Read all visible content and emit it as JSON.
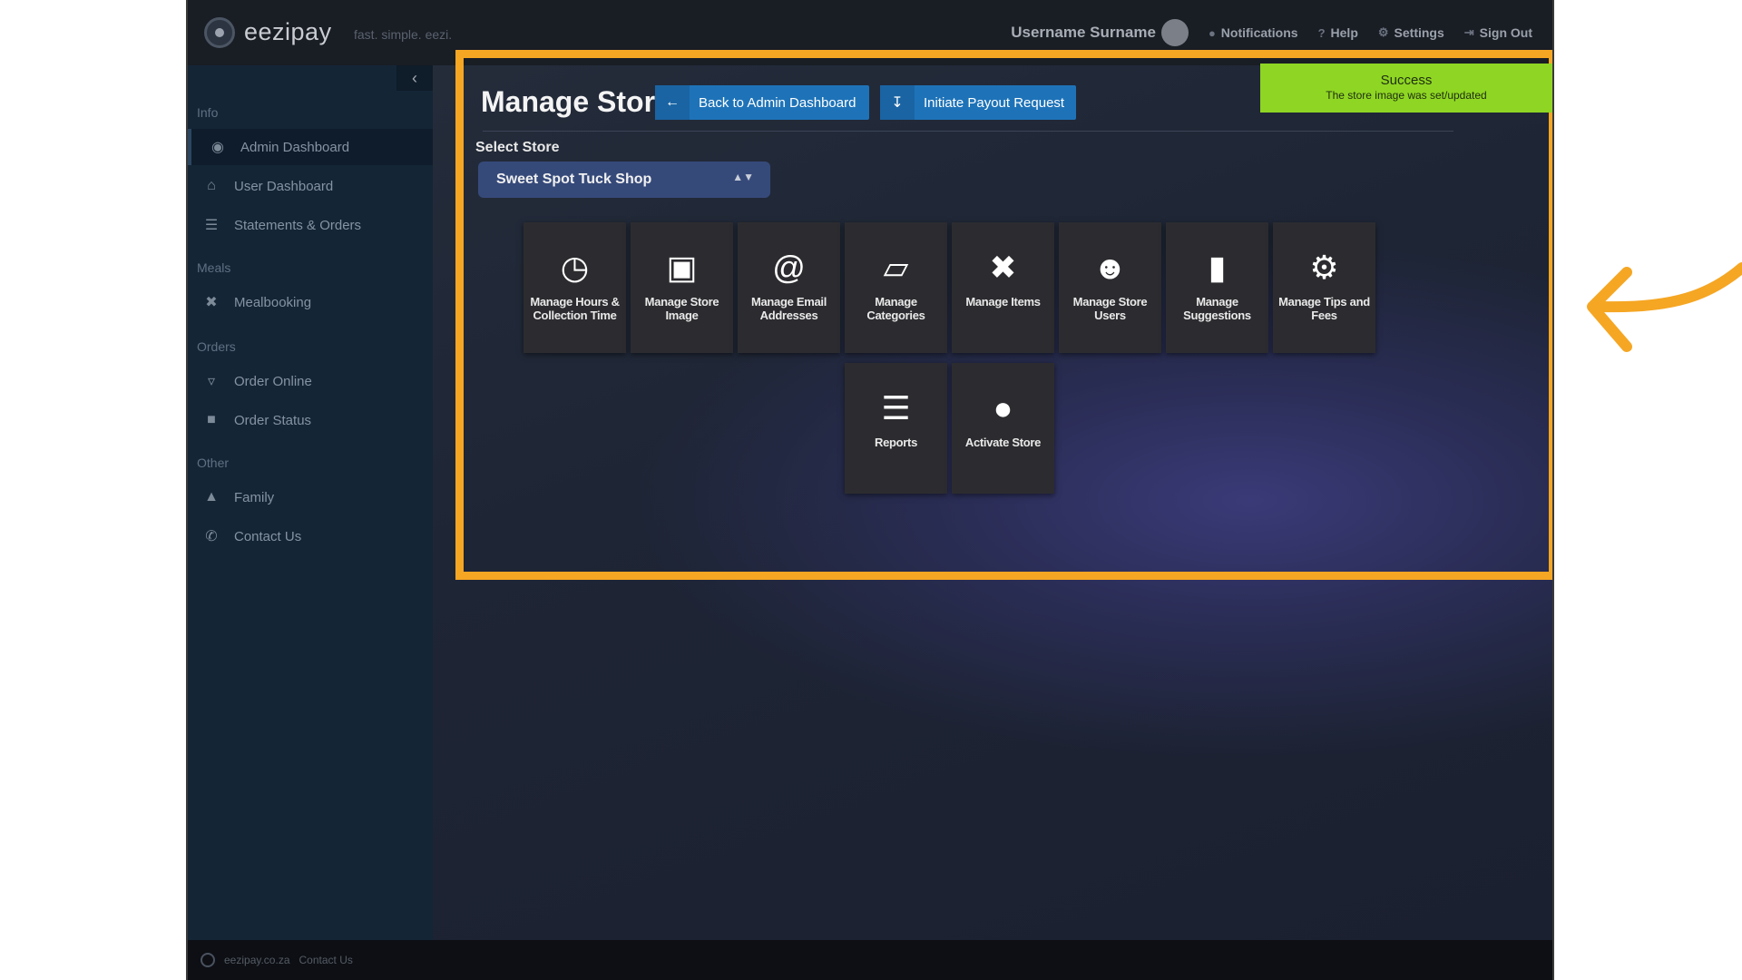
{
  "app": {
    "brand": "eezipay",
    "tagline": "fast. simple. eezi."
  },
  "topnav": {
    "username": "Username Surname",
    "notifications": "Notifications",
    "help": "Help",
    "settings": "Settings",
    "sign_out": "Sign Out"
  },
  "sidebar": {
    "collapse_icon": "chevron-left-icon",
    "sections": [
      {
        "label": "Info"
      },
      {
        "label": "Meals"
      },
      {
        "label": "Orders"
      },
      {
        "label": "Other"
      }
    ],
    "items": [
      {
        "label": "Admin Dashboard",
        "icon": "dashboard-icon",
        "active": true
      },
      {
        "label": "User Dashboard",
        "icon": "home-icon"
      },
      {
        "label": "Statements & Orders",
        "icon": "list-icon"
      },
      {
        "label": "Mealbooking",
        "icon": "cutlery-icon"
      },
      {
        "label": "Order Online",
        "icon": "basket-icon"
      },
      {
        "label": "Order Status",
        "icon": "bag-icon"
      },
      {
        "label": "Family",
        "icon": "family-icon"
      },
      {
        "label": "Contact Us",
        "icon": "phone-icon"
      }
    ]
  },
  "main": {
    "title": "Manage Stores",
    "back_button": "Back to Admin Dashboard",
    "payout_button": "Initiate Payout Request",
    "select_label": "Select Store",
    "selected_store": "Sweet Spot Tuck Shop",
    "toast": {
      "title": "Success",
      "message": "The store image was set/updated",
      "color": "#8ed623"
    },
    "tiles": [
      {
        "label": "Manage Hours & Collection Time",
        "icon": "clock-icon"
      },
      {
        "label": "Manage Store Image",
        "icon": "image-icon"
      },
      {
        "label": "Manage Email Addresses",
        "icon": "at-icon"
      },
      {
        "label": "Manage Categories",
        "icon": "folder-open-icon"
      },
      {
        "label": "Manage Items",
        "icon": "cutlery-icon"
      },
      {
        "label": "Manage Store Users",
        "icon": "users-icon"
      },
      {
        "label": "Manage Suggestions",
        "icon": "comment-icon"
      },
      {
        "label": "Manage Tips and Fees",
        "icon": "gear-icon"
      },
      {
        "label": "Reports",
        "icon": "list-icon"
      },
      {
        "label": "Activate Store",
        "icon": "circle-icon"
      }
    ]
  },
  "footer": {
    "site": "eezipay.co.za",
    "contact": "Contact Us"
  },
  "colors": {
    "highlight": "#f5a623",
    "accent": "#1e73b8",
    "sidebar": "#142536"
  }
}
